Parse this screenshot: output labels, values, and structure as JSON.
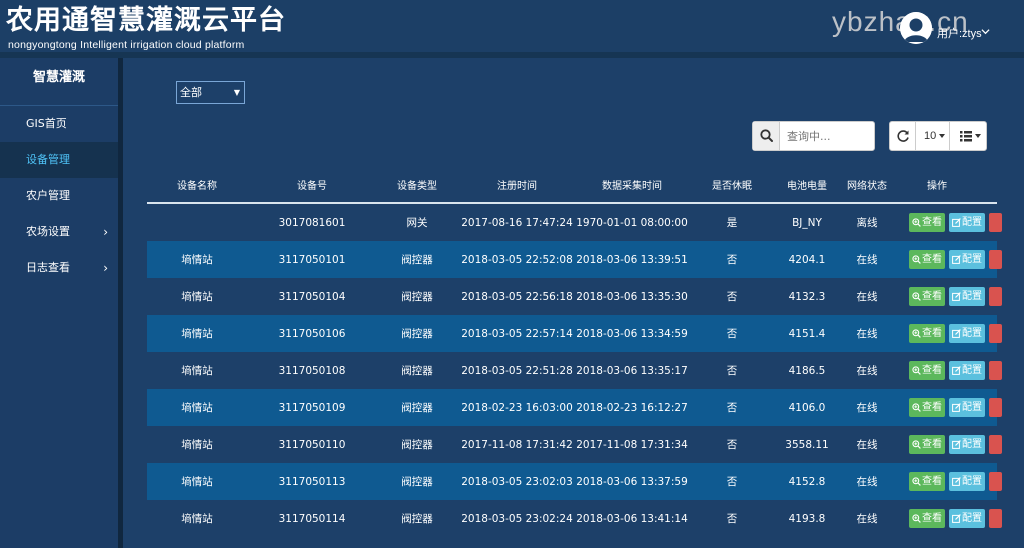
{
  "header": {
    "title": "农用通智慧灌溉云平台",
    "subtitle": "nongyongtong Intelligent irrigation cloud platform",
    "watermark": "ybzhan.cn",
    "user_label": "用户:ztys"
  },
  "sidebar": {
    "title": "智慧灌溉",
    "items": [
      {
        "label": "GIS首页",
        "active": false,
        "has_submenu": false
      },
      {
        "label": "设备管理",
        "active": true,
        "has_submenu": false
      },
      {
        "label": "农户管理",
        "active": false,
        "has_submenu": false
      },
      {
        "label": "农场设置",
        "active": false,
        "has_submenu": true
      },
      {
        "label": "日志查看",
        "active": false,
        "has_submenu": true
      }
    ],
    "chevron": "›"
  },
  "filter": {
    "selected": "全部"
  },
  "search": {
    "placeholder": "查询中..."
  },
  "toolbar": {
    "page_size": "10"
  },
  "table": {
    "columns": [
      "设备名称",
      "设备号",
      "设备类型",
      "注册时间",
      "数据采集时间",
      "是否休眠",
      "电池电量",
      "网络状态",
      "操作"
    ],
    "actions": {
      "view": "查看",
      "config": "配置"
    },
    "rows": [
      {
        "name": "",
        "id": "3017081601",
        "type": "网关",
        "registered": "2017-08-16 17:47:24",
        "collected": "1970-01-01 08:00:00",
        "sleep": "是",
        "battery": "BJ_NY",
        "network": "离线"
      },
      {
        "name": "墒情站",
        "id": "3117050101",
        "type": "阀控器",
        "registered": "2018-03-05 22:52:08",
        "collected": "2018-03-06 13:39:51",
        "sleep": "否",
        "battery": "4204.1",
        "network": "在线"
      },
      {
        "name": "墒情站",
        "id": "3117050104",
        "type": "阀控器",
        "registered": "2018-03-05 22:56:18",
        "collected": "2018-03-06 13:35:30",
        "sleep": "否",
        "battery": "4132.3",
        "network": "在线"
      },
      {
        "name": "墒情站",
        "id": "3117050106",
        "type": "阀控器",
        "registered": "2018-03-05 22:57:14",
        "collected": "2018-03-06 13:34:59",
        "sleep": "否",
        "battery": "4151.4",
        "network": "在线"
      },
      {
        "name": "墒情站",
        "id": "3117050108",
        "type": "阀控器",
        "registered": "2018-03-05 22:51:28",
        "collected": "2018-03-06 13:35:17",
        "sleep": "否",
        "battery": "4186.5",
        "network": "在线"
      },
      {
        "name": "墒情站",
        "id": "3117050109",
        "type": "阀控器",
        "registered": "2018-02-23 16:03:00",
        "collected": "2018-02-23 16:12:27",
        "sleep": "否",
        "battery": "4106.0",
        "network": "在线"
      },
      {
        "name": "墒情站",
        "id": "3117050110",
        "type": "阀控器",
        "registered": "2017-11-08 17:31:42",
        "collected": "2017-11-08 17:31:34",
        "sleep": "否",
        "battery": "3558.11",
        "network": "在线"
      },
      {
        "name": "墒情站",
        "id": "3117050113",
        "type": "阀控器",
        "registered": "2018-03-05 23:02:03",
        "collected": "2018-03-06 13:37:59",
        "sleep": "否",
        "battery": "4152.8",
        "network": "在线"
      },
      {
        "name": "墒情站",
        "id": "3117050114",
        "type": "阀控器",
        "registered": "2018-03-05 23:02:24",
        "collected": "2018-03-06 13:41:14",
        "sleep": "否",
        "battery": "4193.8",
        "network": "在线"
      }
    ]
  },
  "colors": {
    "header_bg": "#1c3f66",
    "main_bg": "#1d4069",
    "row_alt": "#0f5a91",
    "view_button": "#5cb85c",
    "config_button": "#5bc0de",
    "delete_button": "#d9534f",
    "active_link": "#4fc3f7"
  },
  "icons": {
    "search": "search-icon",
    "refresh": "refresh-icon",
    "columns": "list-icon",
    "user": "user-avatar-icon"
  }
}
